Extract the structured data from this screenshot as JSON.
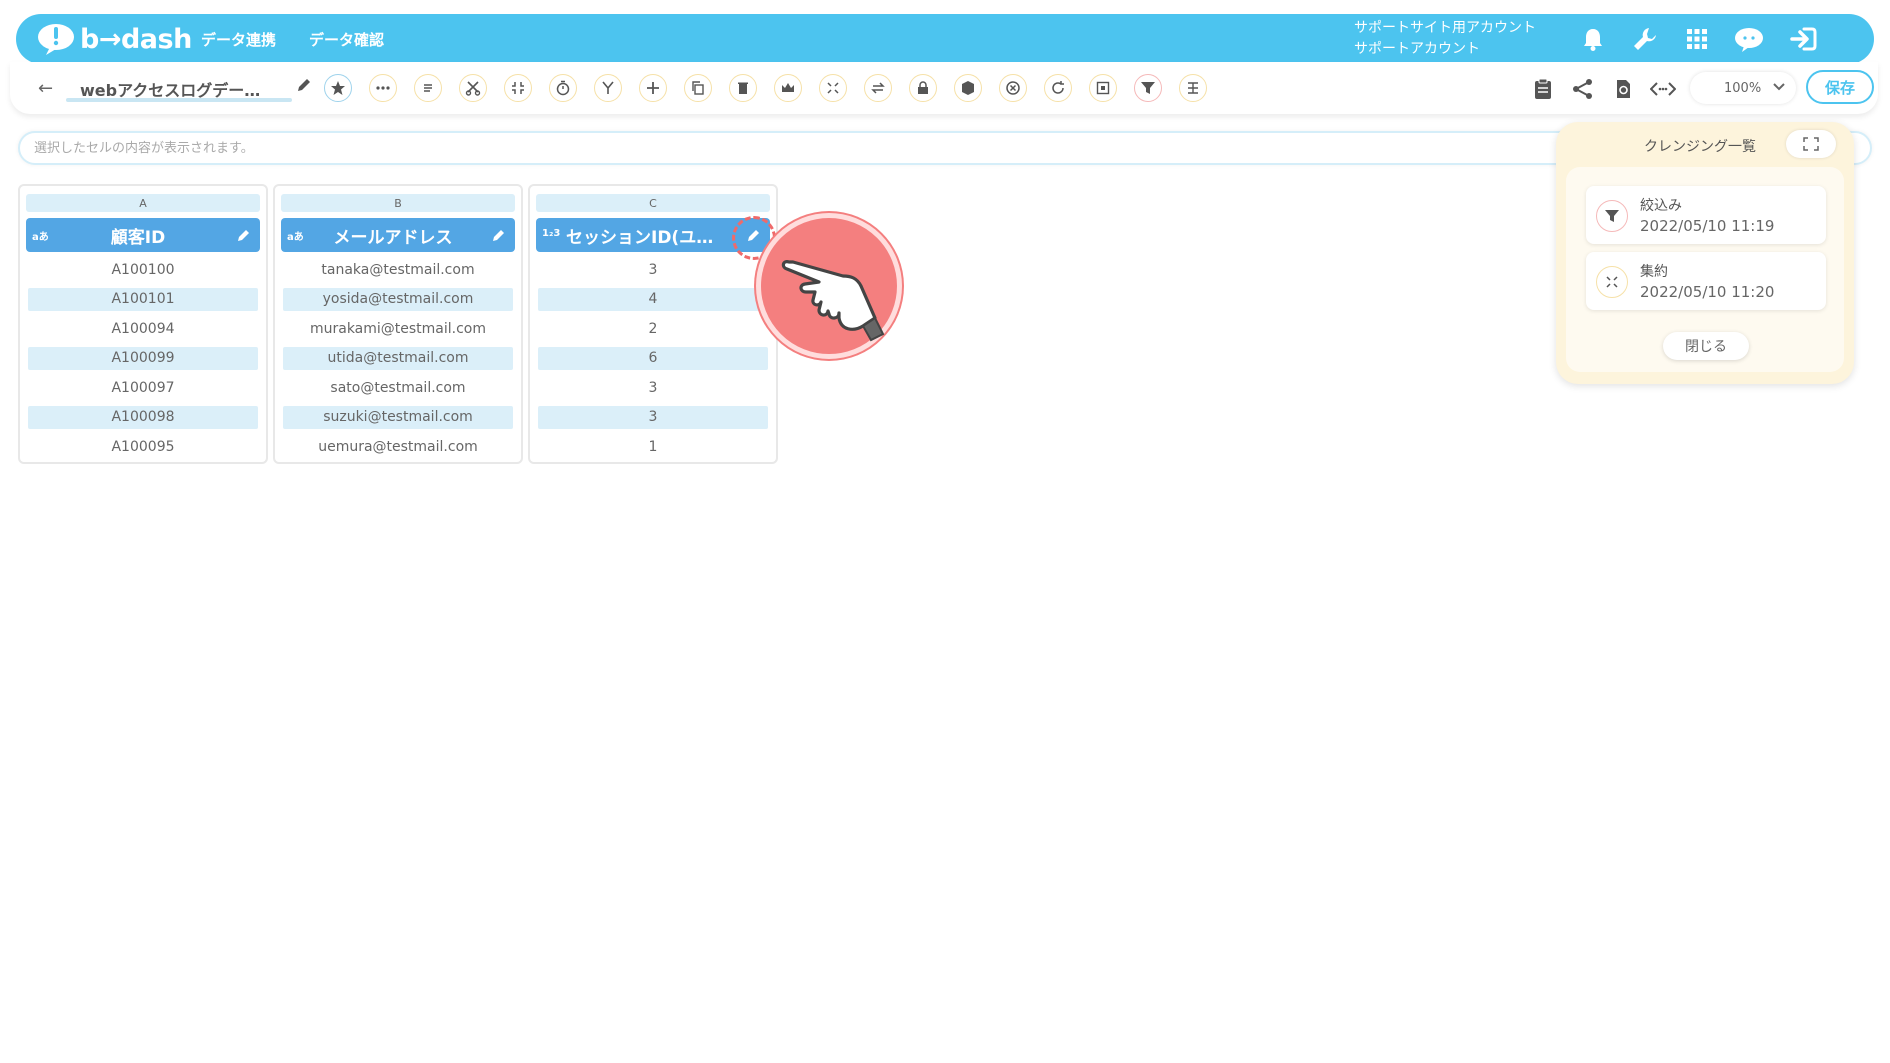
{
  "header": {
    "brand": "b→dash",
    "nav": [
      "データ連携",
      "データ確認"
    ],
    "account_line1": "サポートサイト用アカウント",
    "account_line2": "サポートアカウント",
    "icons": [
      "bell-icon",
      "wrench-icon",
      "grid-icon",
      "cloud-chat-icon",
      "logout-icon"
    ]
  },
  "toolbar": {
    "title": "webアクセスログデー…",
    "zoom": "100%",
    "save_label": "保存",
    "tools": [
      "star",
      "more",
      "list",
      "cut",
      "collapse",
      "timer",
      "merge",
      "add",
      "copy",
      "delete",
      "crown",
      "aggregate",
      "convert",
      "lock",
      "extract",
      "exclude",
      "refresh",
      "frame",
      "filter",
      "split"
    ]
  },
  "cell_bar": {
    "placeholder": "選択したセルの内容が表示されます。"
  },
  "columns": [
    {
      "letter": "A",
      "type": "aあ",
      "name": "顧客ID",
      "values": [
        "A100100",
        "A100101",
        "A100094",
        "A100099",
        "A100097",
        "A100098",
        "A100095"
      ]
    },
    {
      "letter": "B",
      "type": "aあ",
      "name": "メールアドレス",
      "values": [
        "tanaka@testmail.com",
        "yosida@testmail.com",
        "murakami@testmail.com",
        "utida@testmail.com",
        "sato@testmail.com",
        "suzuki@testmail.com",
        "uemura@testmail.com"
      ]
    },
    {
      "letter": "C",
      "type": "1₂3",
      "name": "セッションID(ユニ…",
      "values": [
        "3",
        "4",
        "2",
        "6",
        "3",
        "3",
        "1"
      ]
    }
  ],
  "cleansing": {
    "title": "クレンジング一覧",
    "steps": [
      {
        "name": "絞込み",
        "time": "2022/05/10 11:19",
        "icon": "filter-icon"
      },
      {
        "name": "集約",
        "time": "2022/05/10 11:20",
        "icon": "aggregate-icon"
      }
    ],
    "close_label": "閉じる"
  },
  "colors": {
    "accent": "#4cc4ef",
    "column_header": "#53a6e4",
    "panel_bg": "#fdf4dc",
    "pointer": "#f47f7f"
  }
}
